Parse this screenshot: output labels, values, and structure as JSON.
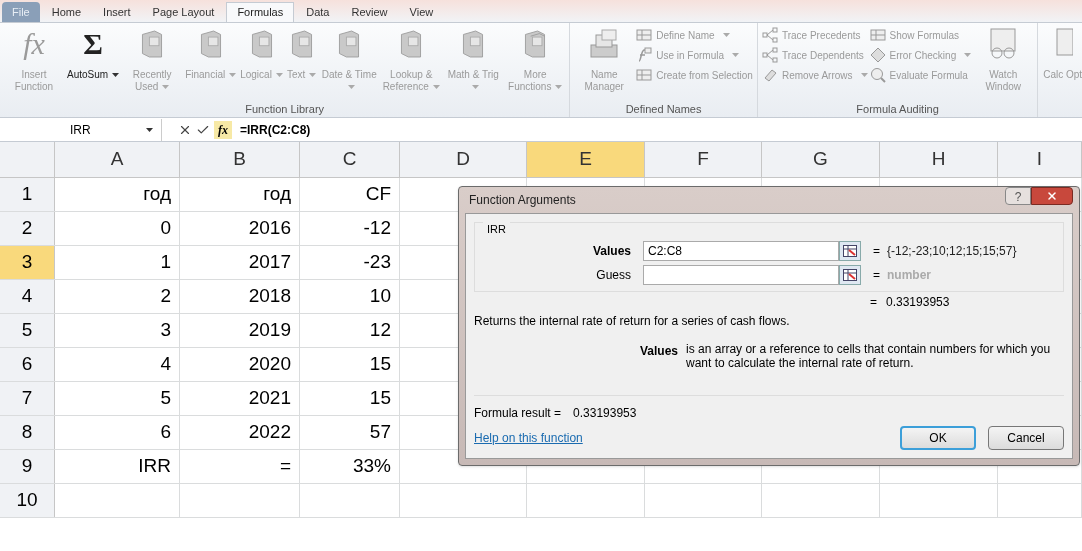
{
  "tabs": [
    {
      "label": "File",
      "kind": "file",
      "selected": false
    },
    {
      "label": "Home",
      "kind": "tab",
      "selected": false
    },
    {
      "label": "Insert",
      "kind": "tab",
      "selected": false
    },
    {
      "label": "Page Layout",
      "kind": "tab",
      "selected": false
    },
    {
      "label": "Formulas",
      "kind": "tab",
      "selected": true
    },
    {
      "label": "Data",
      "kind": "tab",
      "selected": false
    },
    {
      "label": "Review",
      "kind": "tab",
      "selected": false
    },
    {
      "label": "View",
      "kind": "tab",
      "selected": false
    }
  ],
  "ribbon": {
    "groups": [
      {
        "label": "Function Library",
        "items": [
          {
            "kind": "large",
            "label": "Insert Function",
            "glyph": "fx",
            "disabled": true,
            "dropdown": false
          },
          {
            "kind": "large",
            "label": "AutoSum",
            "glyph": "Σ",
            "disabled": false,
            "dropdown": true
          },
          {
            "kind": "large",
            "label": "Recently Used",
            "disabled": true,
            "dropdown": true
          },
          {
            "kind": "large",
            "label": "Financial",
            "disabled": true,
            "dropdown": true
          },
          {
            "kind": "large",
            "label": "Logical",
            "disabled": true,
            "dropdown": true
          },
          {
            "kind": "large",
            "label": "Text",
            "disabled": true,
            "dropdown": true
          },
          {
            "kind": "large",
            "label": "Date & Time",
            "disabled": true,
            "dropdown": true
          },
          {
            "kind": "large",
            "label": "Lookup & Reference",
            "disabled": true,
            "dropdown": true
          },
          {
            "kind": "large",
            "label": "Math & Trig",
            "disabled": true,
            "dropdown": true
          },
          {
            "kind": "large",
            "label": "More Functions",
            "disabled": true,
            "dropdown": true
          }
        ]
      },
      {
        "label": "Defined Names",
        "items": [
          {
            "kind": "large",
            "label": "Name Manager",
            "disabled": true,
            "dropdown": false
          },
          {
            "kind": "small",
            "label": "Define Name",
            "disabled": true,
            "dropdown": true
          },
          {
            "kind": "small",
            "label": "Use in Formula",
            "disabled": true,
            "dropdown": true
          },
          {
            "kind": "small",
            "label": "Create from Selection",
            "disabled": true,
            "dropdown": false
          }
        ]
      },
      {
        "label": "Formula Auditing",
        "items": [
          {
            "kind": "small",
            "label": "Trace Precedents",
            "disabled": true,
            "dropdown": false
          },
          {
            "kind": "small",
            "label": "Trace Dependents",
            "disabled": true,
            "dropdown": false
          },
          {
            "kind": "small",
            "label": "Remove Arrows",
            "disabled": true,
            "dropdown": true
          },
          {
            "kind": "small",
            "label": "Show Formulas",
            "disabled": true,
            "dropdown": false
          },
          {
            "kind": "small",
            "label": "Error Checking",
            "disabled": true,
            "dropdown": true
          },
          {
            "kind": "small",
            "label": "Evaluate Formula",
            "disabled": true,
            "dropdown": false
          },
          {
            "kind": "large",
            "label": "Watch Window",
            "disabled": true,
            "dropdown": false
          }
        ]
      },
      {
        "items": [
          {
            "kind": "large",
            "label": "Calc Opt",
            "disabled": true,
            "dropdown": false
          }
        ]
      }
    ]
  },
  "formula_bar": {
    "name_box": "IRR",
    "fx": "fx",
    "formula": "=IRR(C2:C8)"
  },
  "columns": [
    {
      "label": "A",
      "selected": false
    },
    {
      "label": "B",
      "selected": false
    },
    {
      "label": "C",
      "selected": false
    },
    {
      "label": "D",
      "selected": false
    },
    {
      "label": "E",
      "selected": true
    },
    {
      "label": "F",
      "selected": false
    },
    {
      "label": "G",
      "selected": false
    },
    {
      "label": "H",
      "selected": false
    },
    {
      "label": "I",
      "selected": false
    }
  ],
  "rows": [
    {
      "label": "1",
      "selected": false,
      "cells": [
        "год",
        "год",
        "CF"
      ]
    },
    {
      "label": "2",
      "selected": false,
      "cells": [
        "0",
        "2016",
        "-12"
      ]
    },
    {
      "label": "3",
      "selected": true,
      "cells": [
        "1",
        "2017",
        "-23"
      ]
    },
    {
      "label": "4",
      "selected": false,
      "cells": [
        "2",
        "2018",
        "10"
      ]
    },
    {
      "label": "5",
      "selected": false,
      "cells": [
        "3",
        "2019",
        "12"
      ]
    },
    {
      "label": "6",
      "selected": false,
      "cells": [
        "4",
        "2020",
        "15"
      ]
    },
    {
      "label": "7",
      "selected": false,
      "cells": [
        "5",
        "2021",
        "15"
      ]
    },
    {
      "label": "8",
      "selected": false,
      "cells": [
        "6",
        "2022",
        "57"
      ]
    },
    {
      "label": "9",
      "selected": false,
      "cells": [
        "IRR",
        "=",
        "33%"
      ]
    },
    {
      "label": "10",
      "selected": false,
      "cells": []
    }
  ],
  "dialog": {
    "title": "Function Arguments",
    "help": "?",
    "function": "IRR",
    "arguments": [
      {
        "label": "Values",
        "required": true,
        "value": "C2:C8",
        "equals": "=",
        "result": "{-12;-23;10;12;15;15;57}",
        "dimmed": false
      },
      {
        "label": "Guess",
        "required": false,
        "equals": "=",
        "result": "number",
        "dimmed": true
      }
    ],
    "result_equals": "=",
    "result": "0.33193953",
    "description": "Returns the internal rate of return for a series of cash flows.",
    "arg_name": "Values",
    "arg_description": "is an array or a reference to cells that contain numbers for which you want to calculate the internal rate of return.",
    "formula_result_label": "Formula result =",
    "formula_result": "0.33193953",
    "help_link": "Help on this function",
    "buttons": [
      {
        "label": "OK",
        "default": true
      },
      {
        "label": "Cancel",
        "default": false
      }
    ]
  }
}
